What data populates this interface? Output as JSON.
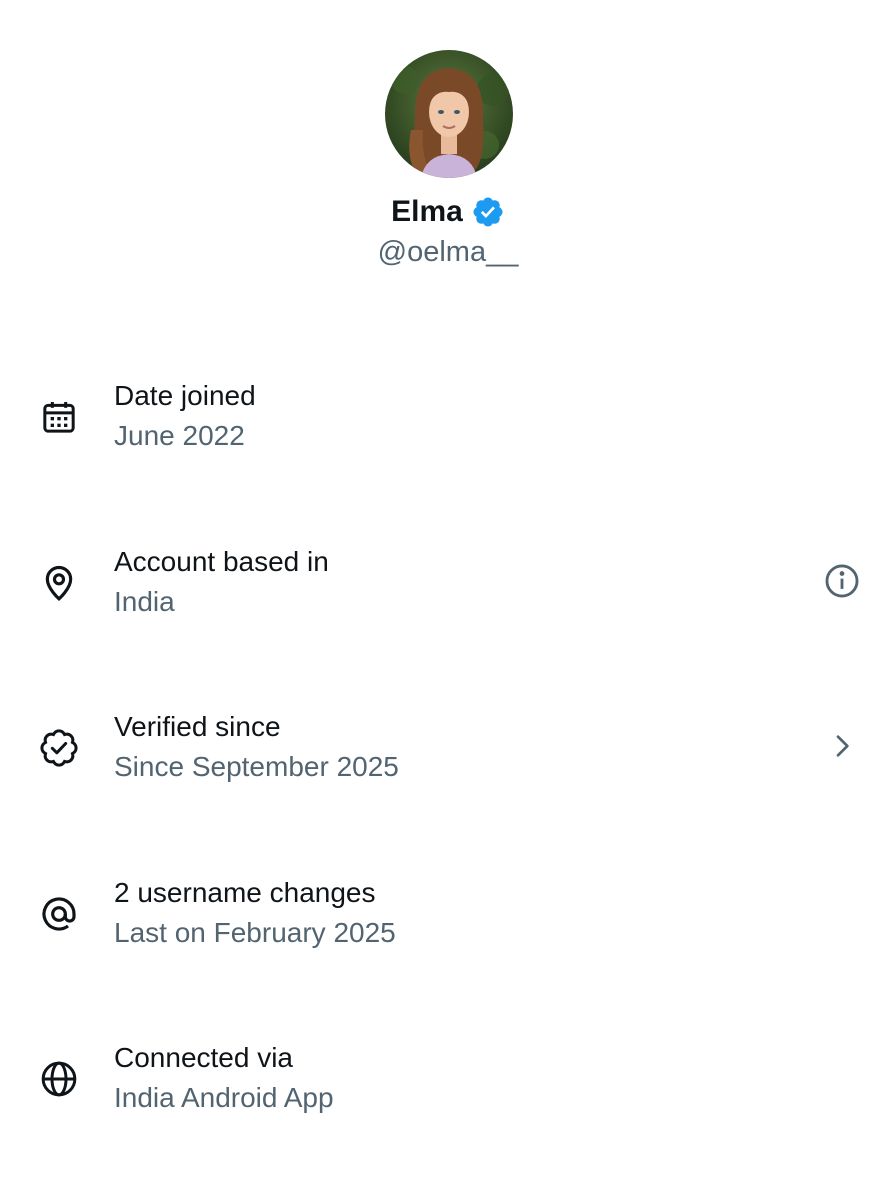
{
  "profile": {
    "name": "Elma",
    "handle": "@oelma__",
    "verified_color": "#1d9bf0"
  },
  "rows": [
    {
      "icon": "calendar-icon",
      "title": "Date joined",
      "value": "June 2022"
    },
    {
      "icon": "location-pin-icon",
      "title": "Account based in",
      "value": "India",
      "action_icon": "info-icon"
    },
    {
      "icon": "verified-badge-outline-icon",
      "title": "Verified since",
      "value": "Since September 2025",
      "action_icon": "chevron-right-icon"
    },
    {
      "icon": "at-sign-icon",
      "title": "2 username changes",
      "value": "Last on February 2025"
    },
    {
      "icon": "globe-icon",
      "title": "Connected via",
      "value": "India Android App"
    }
  ],
  "colors": {
    "primary_text": "#0f1419",
    "secondary_text": "#536471",
    "accent": "#1d9bf0"
  }
}
